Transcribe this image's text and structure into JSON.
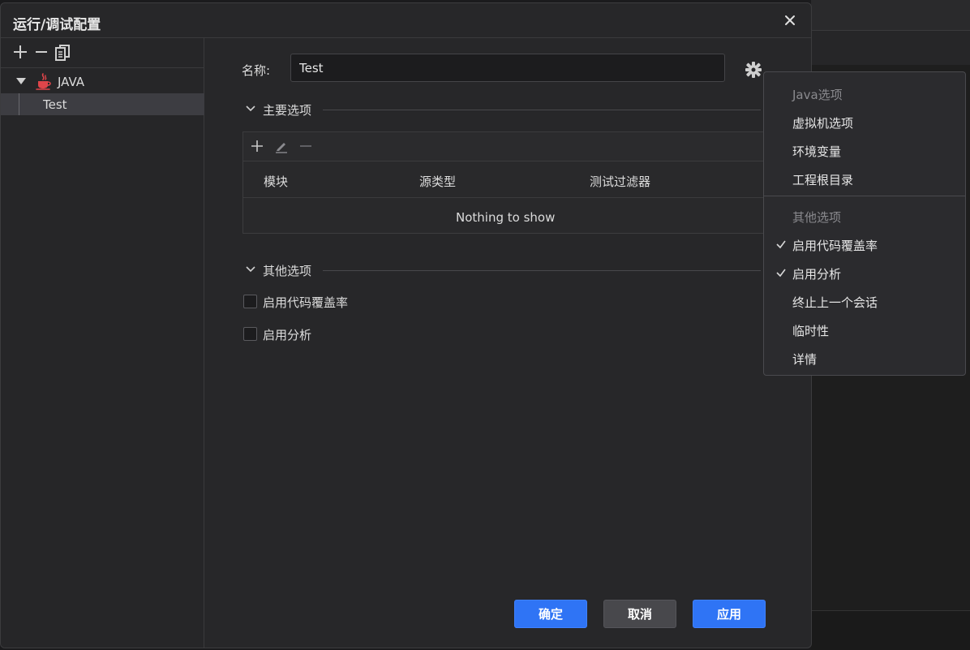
{
  "dialog": {
    "title": "运行/调试配置"
  },
  "tree": {
    "root_label": "JAVA",
    "child_label": "Test"
  },
  "form": {
    "name_label": "名称:",
    "name_value": "Test"
  },
  "main_options": {
    "title": "主要选项",
    "columns": [
      "模块",
      "源类型",
      "测试过滤器"
    ],
    "empty_text": "Nothing to show"
  },
  "other_options": {
    "title": "其他选项",
    "checkboxes": [
      {
        "label": "启用代码覆盖率",
        "checked": false
      },
      {
        "label": "启用分析",
        "checked": false
      }
    ]
  },
  "buttons": {
    "ok": "确定",
    "cancel": "取消",
    "apply": "应用"
  },
  "popup_menu": {
    "java_heading": "Java选项",
    "java_items": [
      "虚拟机选项",
      "环境变量",
      "工程根目录"
    ],
    "other_heading": "其他选项",
    "other_items": [
      {
        "label": "启用代码覆盖率",
        "checked": true
      },
      {
        "label": "启用分析",
        "checked": true
      },
      {
        "label": "终止上一个会话",
        "checked": false
      },
      {
        "label": "临时性",
        "checked": false
      },
      {
        "label": "详情",
        "checked": false
      }
    ]
  },
  "colors": {
    "primary_button": "#2f74f5",
    "java_icon": "#e0454a"
  }
}
